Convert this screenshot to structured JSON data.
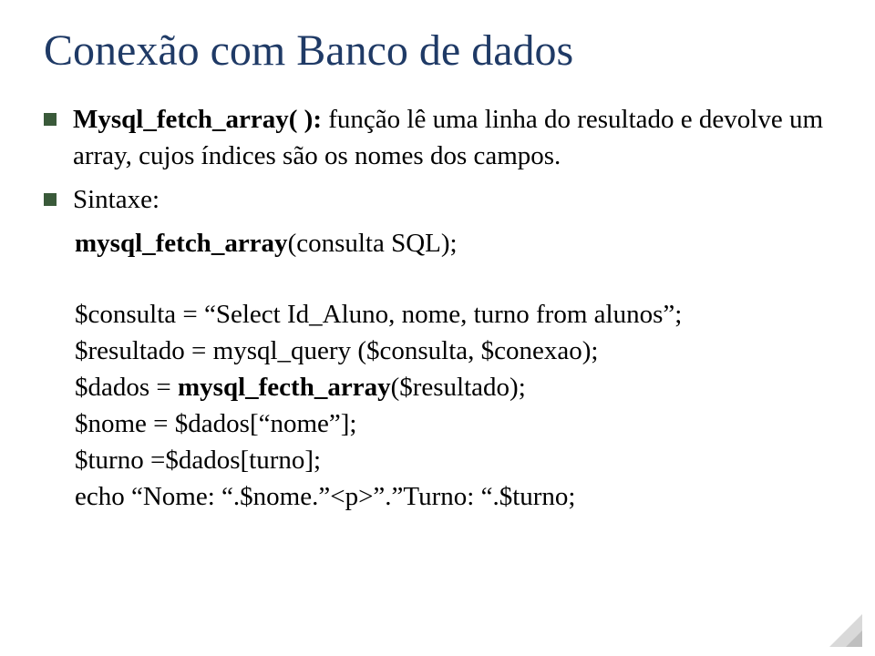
{
  "title": "Conexão com Banco de dados",
  "bullet1": {
    "func": "Mysql_fetch_array( ):",
    "desc": " função lê uma linha do resultado e devolve um array, cujos índices são os nomes dos campos."
  },
  "bullet2": {
    "label": "Sintaxe:",
    "syntax_fn": "mysql_fetch_array",
    "syntax_rest": "(consulta SQL);"
  },
  "code": {
    "l1": "$consulta = “Select Id_Aluno, nome, turno from alunos”;",
    "l2a": "$resultado = mysql_query ($consulta, $conexao);",
    "l3_pre": "$dados = ",
    "l3_bold": "mysql_fecth_array",
    "l3_post": "($resultado);",
    "l4": "$nome = $dados[“nome”];",
    "l5": "$turno =$dados[turno];",
    "l6": "echo “Nome: “.$nome.”<p>”.”Turno: “.$turno;"
  }
}
